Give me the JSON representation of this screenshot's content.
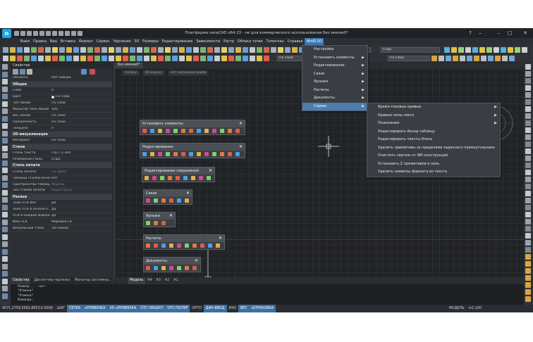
{
  "window": {
    "title": "Платформа nanoCAD x64 23 - не для коммерческого использования Без имени0*",
    "logo_letter": "n"
  },
  "menubar": [
    "Файл",
    "Правка",
    "Вид",
    "Вставка",
    "Формат",
    "Сервис",
    "Черчение",
    "3D",
    "Размеры",
    "Редактирование",
    "Зависимости",
    "Растр",
    "Облака точек",
    "Топоплан",
    "Справка",
    "WinELSO"
  ],
  "menubar_active": "WinELSO",
  "toolbar": {
    "style_combo": "ГОСТ 2.304",
    "layer_combo": "По слою",
    "scale_combo": "СПДС",
    "linetype_combo": "По слою"
  },
  "properties": {
    "title": "Свойства",
    "object_row": {
      "key": "Объекты",
      "value": "Нет набора"
    },
    "sections": [
      {
        "name": "Общие",
        "rows": [
          {
            "key": "Слой",
            "value": "0"
          },
          {
            "key": "Цвет",
            "value": "По слою",
            "swatch": true
          },
          {
            "key": "Тип линий",
            "value": "По слою"
          },
          {
            "key": "Масштаб типа линий",
            "value": "100"
          },
          {
            "key": "Вес линий",
            "value": "По слою"
          },
          {
            "key": "Прозрачность",
            "value": "По слою"
          },
          {
            "key": "Толщина",
            "value": "0"
          }
        ]
      },
      {
        "name": "3D-визуализация",
        "rows": [
          {
            "key": "Материал",
            "value": "По слою"
          }
        ]
      },
      {
        "name": "Стили",
        "rows": [
          {
            "key": "Стиль текста",
            "value": "ГОСТ 2.304"
          },
          {
            "key": "Размерный стиль",
            "value": "СПДС"
          }
        ]
      },
      {
        "name": "Стиль печати",
        "rows": [
          {
            "key": "Стиль печати",
            "value": "По цвету",
            "dim": true
          },
          {
            "key": "Таблица стилей печати",
            "value": "Нет"
          },
          {
            "key": "Пространство таблиц...",
            "value": "Модель",
            "dim": true
          },
          {
            "key": "Тип стилей печати",
            "value": "Недоступно",
            "dim": true
          }
        ]
      },
      {
        "name": "Разное",
        "rows": [
          {
            "key": "Знак ПСК Вкл",
            "value": "Да"
          },
          {
            "key": "Знак ПСК в начале к...",
            "value": "Да"
          },
          {
            "key": "ПСК в каждом ВЭкране",
            "value": "Да"
          },
          {
            "key": "Имя ПСК",
            "value": "Мировая СК"
          },
          {
            "key": "Визуальный стиль",
            "value": "2D-каркас"
          }
        ]
      }
    ]
  },
  "panel_tabs": [
    "Свойства",
    "Диспетчер чертежа",
    "Монитор системны..."
  ],
  "doc_tab": "Без имени0*",
  "breadcrumbs": [
    "Сверху",
    "2D-каркас",
    "нет связанных видов"
  ],
  "floating_toolbars": [
    {
      "title": "Установить элементы"
    },
    {
      "title": "Редактирование"
    },
    {
      "title": "Редактирование соединений"
    },
    {
      "title": "Связи"
    },
    {
      "title": "Ярлыки"
    },
    {
      "title": "Расчеты"
    },
    {
      "title": "Документы"
    }
  ],
  "winelso_menu": [
    {
      "label": "Настройки",
      "arrow": false
    },
    {
      "label": "Установить элементы",
      "arrow": true
    },
    {
      "label": "Редактирование",
      "arrow": true
    },
    {
      "label": "Связи",
      "arrow": true
    },
    {
      "label": "Ярлыки",
      "arrow": true
    },
    {
      "label": "Расчеты",
      "arrow": true
    },
    {
      "label": "Документы",
      "arrow": true
    },
    {
      "label": "Сервис",
      "arrow": true,
      "highlight": true
    }
  ],
  "service_submenu": [
    {
      "label": "Время-токовые кривые",
      "arrow": true
    },
    {
      "label": "Кривые силы света",
      "arrow": true
    },
    {
      "label": "Пожелания",
      "arrow": true
    },
    {
      "label": "Редактировать Аксед-таблицу",
      "arrow": false
    },
    {
      "label": "Редактировать тексты блока",
      "arrow": false
    },
    {
      "label": "Удалить примитивы за пределами заданного прямоугольника",
      "arrow": false
    },
    {
      "label": "Очистить чертеж от WE-конструкций",
      "arrow": false
    },
    {
      "label": "Установить Z примитивов в ноль",
      "arrow": false
    },
    {
      "label": "Удалить символы формата из текста",
      "arrow": false
    }
  ],
  "layout_tabs": [
    "Модель",
    "A4",
    "A3",
    "A2",
    "A1"
  ],
  "command_line": [
    "Размер... -нет-",
    "*Отмена*",
    "*Отмена*",
    "Команда:"
  ],
  "status_bar": {
    "coords": "4571.2759,5091.8053,0.0000",
    "toggles": [
      {
        "label": "ШАГ",
        "on": false
      },
      {
        "label": "СЕТКА",
        "on": true
      },
      {
        "label": "оПРИВЯЗКА",
        "on": true
      },
      {
        "label": "3D оПРИВЯЗКА",
        "on": true
      },
      {
        "label": "ОТС-ОБЪЕКТ",
        "on": true
      },
      {
        "label": "ОТС-ПОЛЯР",
        "on": true
      },
      {
        "label": "ОРТО",
        "on": false
      },
      {
        "label": "ДИН-ВВОД",
        "on": true
      },
      {
        "label": "ИЗО",
        "on": false
      },
      {
        "label": "ВЕС",
        "on": true
      },
      {
        "label": "ШТРИХОВКА",
        "on": true
      }
    ],
    "model_label": "МОДЕЛЬ",
    "scale": "m1:100"
  }
}
